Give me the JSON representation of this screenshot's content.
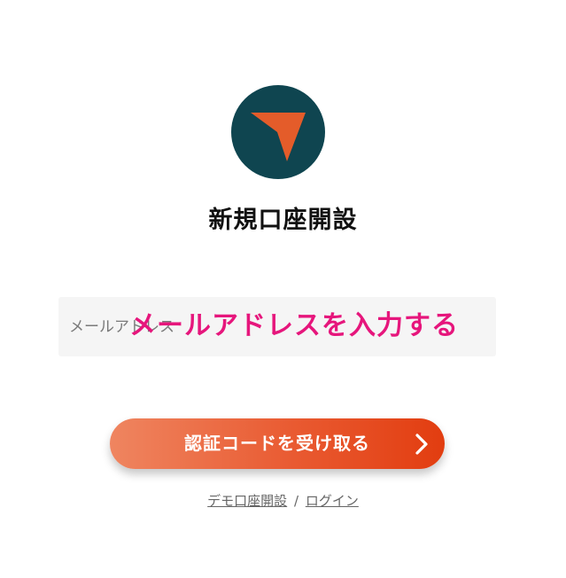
{
  "logo": {
    "icon": "arrow-pointer-icon",
    "background_color": "#0f4550",
    "arrow_color": "#e45c2a"
  },
  "page": {
    "title": "新規口座開設"
  },
  "email": {
    "placeholder": "メールアドレス",
    "value": "",
    "annotation": "メールアドレスを入力する"
  },
  "submit": {
    "label": "認証コードを受け取る",
    "icon": "chevron-right-icon"
  },
  "footer": {
    "demo_link": "デモ口座開設",
    "separator": "/",
    "login_link": "ログイン"
  },
  "colors": {
    "accent_gradient_start": "#ef8560",
    "accent_gradient_end": "#e23d10",
    "annotation": "#e6167c",
    "field_background": "#f5f5f5"
  }
}
